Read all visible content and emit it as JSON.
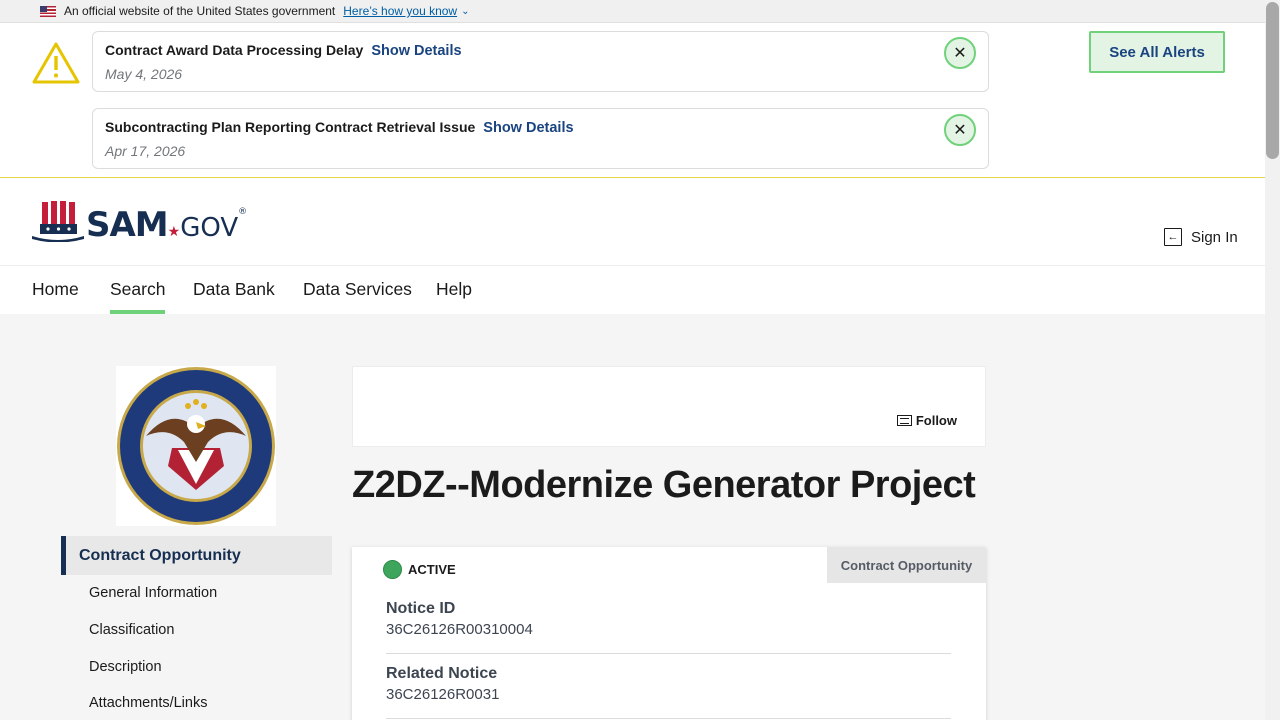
{
  "gov_banner": {
    "text": "An official website of the United States government",
    "link": "Here’s how you know"
  },
  "alerts": [
    {
      "title": "Contract Award Data Processing Delay",
      "action": "Show Details",
      "date": "May 4, 2026"
    },
    {
      "title": "Subcontracting Plan Reporting Contract Retrieval Issue",
      "action": "Show Details",
      "date": "Apr 17, 2026"
    }
  ],
  "see_all_alerts": "See All Alerts",
  "header": {
    "logo_sam": "SAM",
    "logo_gov": "GOV",
    "sign_in": "Sign In"
  },
  "nav": {
    "items": [
      "Home",
      "Search",
      "Data Bank",
      "Data Services",
      "Help"
    ],
    "active": "Search"
  },
  "sidenav": {
    "heading": "Contract Opportunity",
    "items": [
      "General Information",
      "Classification",
      "Description",
      "Attachments/Links"
    ]
  },
  "follow": "Follow",
  "opportunity": {
    "title": "Z2DZ--Modernize Generator Project",
    "status": "ACTIVE",
    "type": "Contract Opportunity",
    "fields": [
      {
        "label": "Notice ID",
        "value": "36C26126R00310004"
      },
      {
        "label": "Related Notice",
        "value": "36C26126R0031"
      }
    ]
  },
  "colors": {
    "accent_green": "#70d17b",
    "navy": "#162e51",
    "link_blue": "#1a4480",
    "status_active": "#3ea65c"
  }
}
